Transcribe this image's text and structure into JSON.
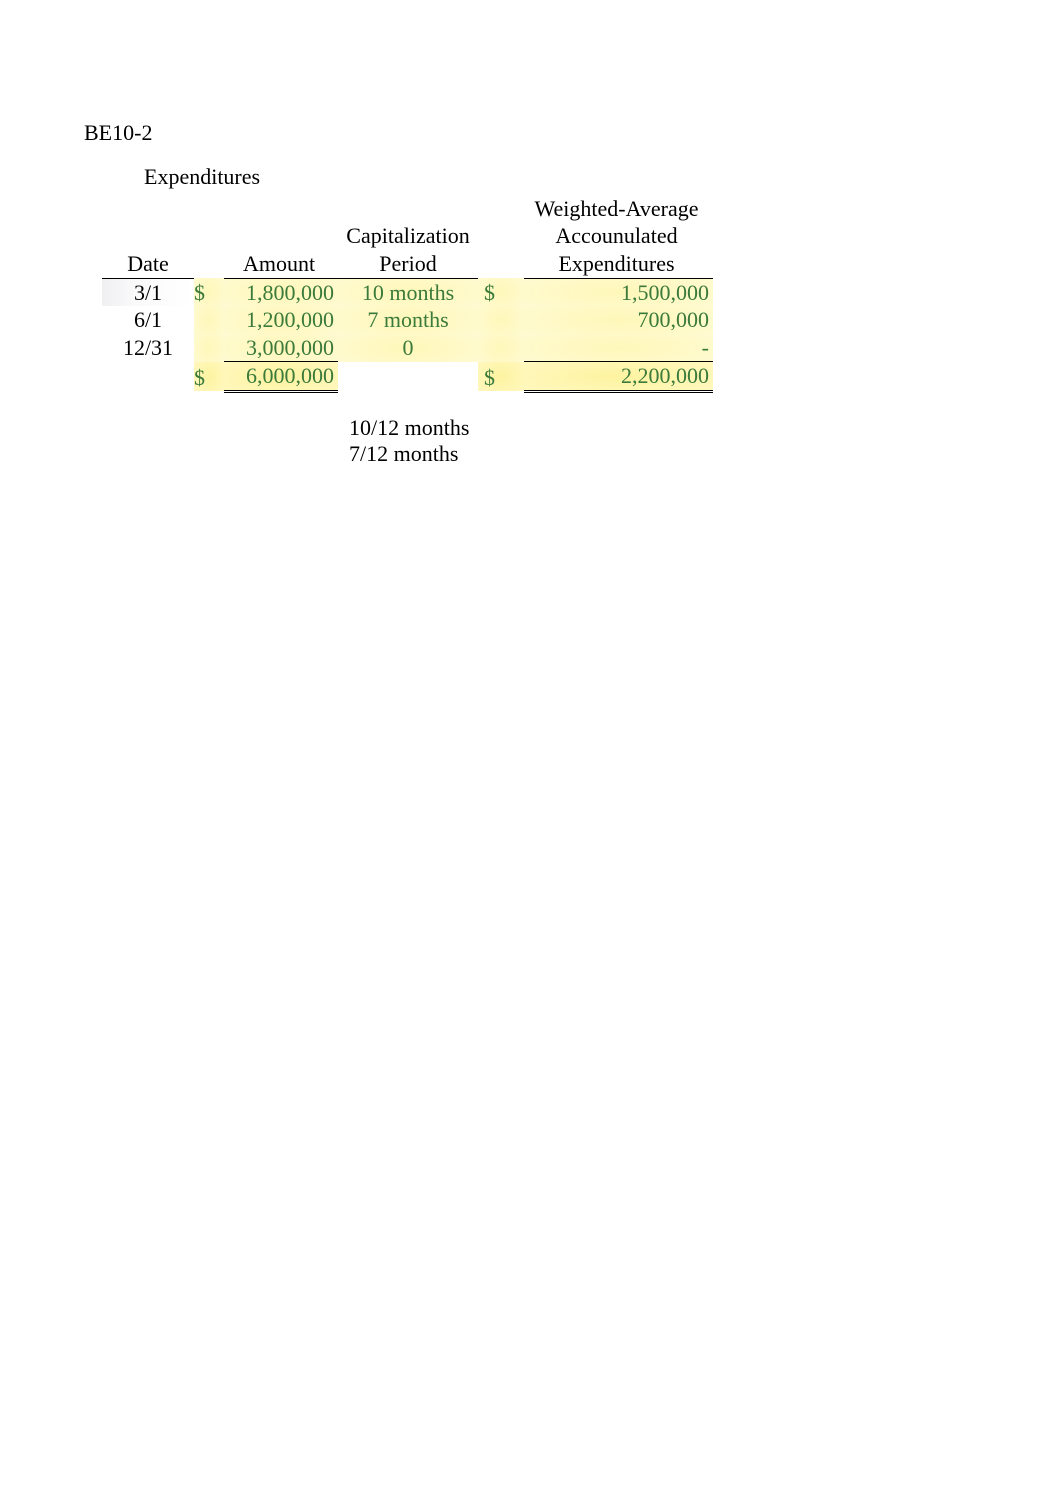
{
  "title": "BE10-2",
  "expenditures_label": "Expenditures",
  "headers": {
    "date": "Date",
    "amount": "Amount",
    "period": "Capitalization\nPeriod",
    "wavg": "Weighted-Average\nAccounulated\nExpenditures"
  },
  "rows": [
    {
      "date": "3/1",
      "cur": "$",
      "amount": "1,800,000",
      "period": "10 months",
      "cur2": "$",
      "wavg": "1,500,000"
    },
    {
      "date": "6/1",
      "cur": "",
      "amount": "1,200,000",
      "period": "7 months",
      "cur2": "",
      "wavg": "700,000"
    },
    {
      "date": "12/31",
      "cur": "",
      "amount": "3,000,000",
      "period": "0",
      "cur2": "",
      "wavg": "-"
    }
  ],
  "totals": {
    "cur": "$",
    "amount": "6,000,000",
    "cur2": "$",
    "wavg": "2,200,000"
  },
  "notes": {
    "line1": "10/12 months",
    "line2": "7/12 months"
  }
}
